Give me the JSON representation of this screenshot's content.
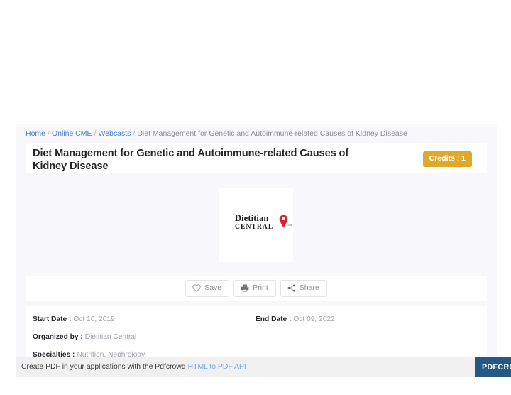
{
  "breadcrumb": {
    "items": [
      {
        "label": "Home",
        "type": "link"
      },
      {
        "label": "Online CME",
        "type": "link"
      },
      {
        "label": "Webcasts",
        "type": "link"
      },
      {
        "label": "Diet Management for Genetic and Autoimmune-related Causes of Kidney Disease",
        "type": "current"
      }
    ],
    "separator": "/"
  },
  "header": {
    "title": "Diet Management for Genetic and Autoimmune-related Causes of Kidney Disease",
    "credits_badge": "Credits : 1",
    "credits_badge_color": "#e0a829"
  },
  "logo": {
    "line1": "Dietitian",
    "line2": "CENTRAL",
    "suffix": ".com",
    "pin_color": "#d8232a",
    "alt": "Dietitian Central logo"
  },
  "actions": {
    "save_label": "Save",
    "print_label": "Print",
    "share_label": "Share"
  },
  "details": {
    "start_date_label": "Start Date :",
    "start_date_value": "Oct 10, 2019",
    "end_date_label": "End Date :",
    "end_date_value": "Oct 09, 2022",
    "organized_by_label": "Organized by :",
    "organized_by_value": "Dietitian Central",
    "specialties_label": "Specialties :",
    "specialties_value": "Nutrition, Nephrology"
  },
  "footer": {
    "text": "Create PDF in your applications with the Pdfcrowd",
    "link_label": "HTML to PDF API",
    "badge_label": "PDFCROWD",
    "badge_color": "#255884",
    "link_color": "#74a8dc"
  }
}
